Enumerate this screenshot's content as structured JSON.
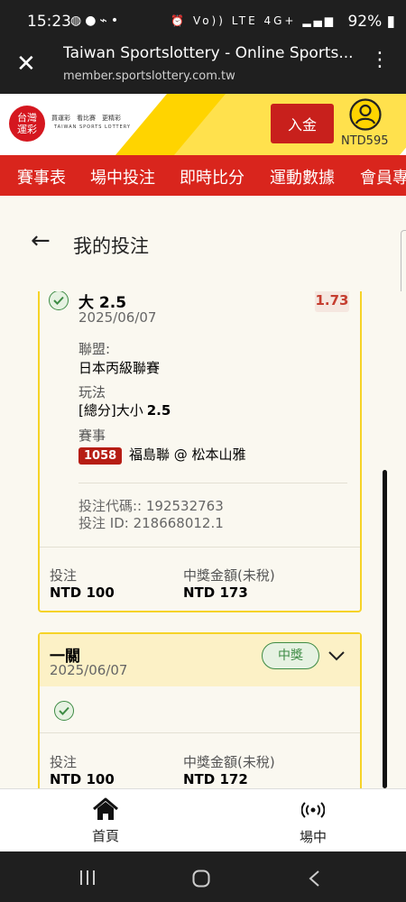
{
  "status_bar": {
    "time": "15:23",
    "battery": "92%",
    "network": "Vo)) LTE 4G+"
  },
  "browser": {
    "title": "Taiwan Sportslottery - Online Sports...",
    "url": "member.sportslottery.com.tw"
  },
  "header": {
    "logo_text_line1": "台灣",
    "logo_text_line2": "運彩",
    "tagline": "買運彩　看比賽　更精彩",
    "tagline_en": "TAIWAN SPORTS LOTTERY",
    "deposit_label": "入金",
    "balance": "NTD595"
  },
  "nav": {
    "items": [
      "賽事表",
      "場中投注",
      "即時比分",
      "運動數據",
      "會員專"
    ]
  },
  "page": {
    "title": "我的投注"
  },
  "bet1": {
    "selection": "大 2.5",
    "date": "2025/06/07",
    "odds": "1.73",
    "league_label": "聯盟:",
    "league": "日本丙級聯賽",
    "play_label": "玩法",
    "play_prefix": "[總分]大小",
    "play_value": "2.5",
    "event_label": "賽事",
    "match_number": "1058",
    "match": "福島聯 @ 松本山雅",
    "bet_code": "投注代碼:: 192532763",
    "bet_id": "投注 ID: 218668012.1",
    "stake_label": "投注",
    "stake": "NTD 100",
    "prize_label": "中獎金額(未稅)",
    "prize": "NTD 173"
  },
  "bet2": {
    "type": "一關",
    "date": "2025/06/07",
    "status": "中獎",
    "stake_label": "投注",
    "stake": "NTD 100",
    "prize_label": "中獎金額(未稅)",
    "prize": "NTD 172"
  },
  "bottom_nav": {
    "home_label": "首頁",
    "live_label": "場中"
  },
  "colors": {
    "brand_red": "#d9251d",
    "accent_yellow": "#f6d327",
    "win_green": "#3d8b44"
  }
}
